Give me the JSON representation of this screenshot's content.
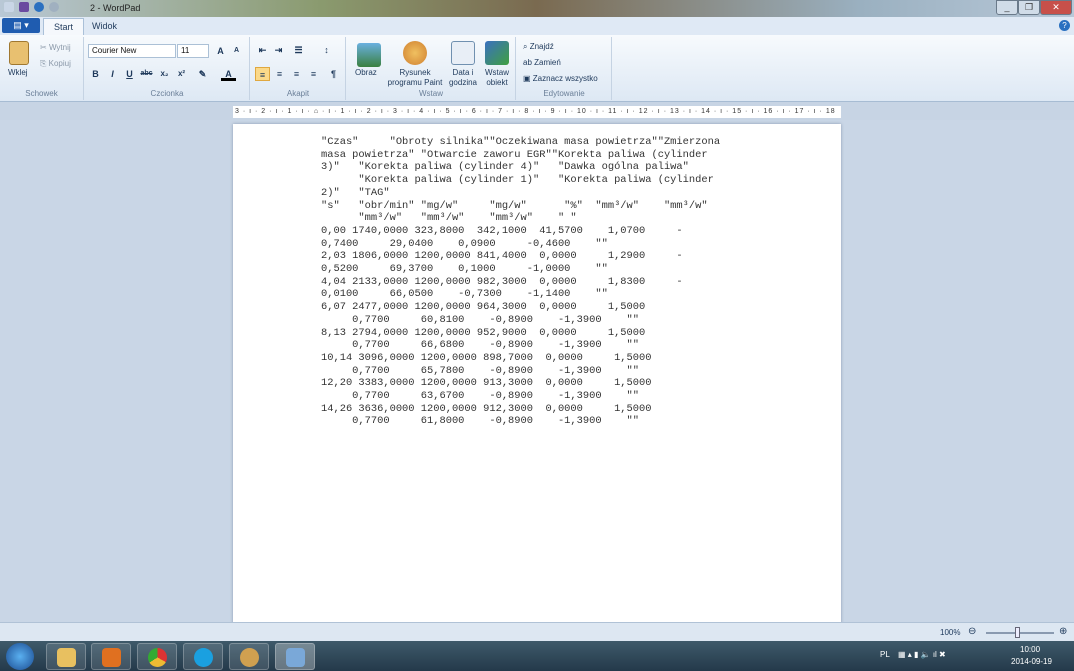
{
  "window": {
    "title": "2 - WordPad"
  },
  "tabs": {
    "file": "▤ ▾",
    "start": "Start",
    "view": "Widok"
  },
  "ribbon": {
    "clipboard": {
      "paste": "Wklej",
      "cut": "Wytnij",
      "copy": "Kopiuj",
      "label": "Schowek"
    },
    "font": {
      "family": "Courier New",
      "size": "11",
      "label": "Czcionka"
    },
    "paragraph": {
      "label": "Akapit"
    },
    "insert": {
      "picture": "Obraz",
      "paint": "Rysunek programu Paint",
      "datetime": "Data i godzina",
      "object": "Wstaw obiekt",
      "label": "Wstaw"
    },
    "editing": {
      "find": "Znajdź",
      "replace": "Zamień",
      "select_all": "Zaznacz wszystko",
      "label": "Edytowanie"
    }
  },
  "ruler": "3 · ı · 2 · ı · 1 · ı · ⌂ · ı · 1 · ı · 2 · ı · 3 · ı · 4 · ı · 5 · ı · 6 · ı · 7 · ı · 8 · ı · 9 · ı · 10 · ı · 11 · ı · 12 · ı · 13 · ı · 14 · ı · 15 · ı · 16 · ı · 17 · ı · 18",
  "document": {
    "lines": [
      "\"Czas\"     \"Obroty silnika\"\"Oczekiwana masa powietrza\"\"Zmierzona",
      "masa powietrza\" \"Otwarcie zaworu EGR\"\"Korekta paliwa (cylinder",
      "3)\"   \"Korekta paliwa (cylinder 4)\"   \"Dawka ogólna paliwa\"",
      "      \"Korekta paliwa (cylinder 1)\"   \"Korekta paliwa (cylinder",
      "2)\"   \"TAG\"",
      "\"s\"   \"obr/min\" \"mg/w\"     \"mg/w\"      \"%\"  \"mm³/w\"    \"mm³/w\"",
      "      \"mm³/w\"   \"mm³/w\"    \"mm³/w\"    \" \"",
      "0,00 1740,0000 323,8000  342,1000  41,5700    1,0700     -",
      "0,7400     29,0400    0,0900     -0,4600    \"\"",
      "2,03 1806,0000 1200,0000 841,4000  0,0000     1,2900     -",
      "0,5200     69,3700    0,1000     -1,0000    \"\"",
      "4,04 2133,0000 1200,0000 982,3000  0,0000     1,8300     -",
      "0,0100     66,0500    -0,7300    -1,1400    \"\"",
      "6,07 2477,0000 1200,0000 964,3000  0,0000     1,5000",
      "     0,7700     60,8100    -0,8900    -1,3900    \"\"",
      "8,13 2794,0000 1200,0000 952,9000  0,0000     1,5000",
      "     0,7700     66,6800    -0,8900    -1,3900    \"\"",
      "10,14 3096,0000 1200,0000 898,7000  0,0000     1,5000",
      "     0,7700     65,7800    -0,8900    -1,3900    \"\"",
      "12,20 3383,0000 1200,0000 913,3000  0,0000     1,5000",
      "     0,7700     63,6700    -0,8900    -1,3900    \"\"",
      "14,26 3636,0000 1200,0000 912,3000  0,0000     1,5000",
      "     0,7700     61,8000    -0,8900    -1,3900    \"\""
    ]
  },
  "status": {
    "zoom": "100%"
  },
  "taskbar": {
    "lang": "PL",
    "time": "10:00",
    "date": "2014-09-19"
  }
}
